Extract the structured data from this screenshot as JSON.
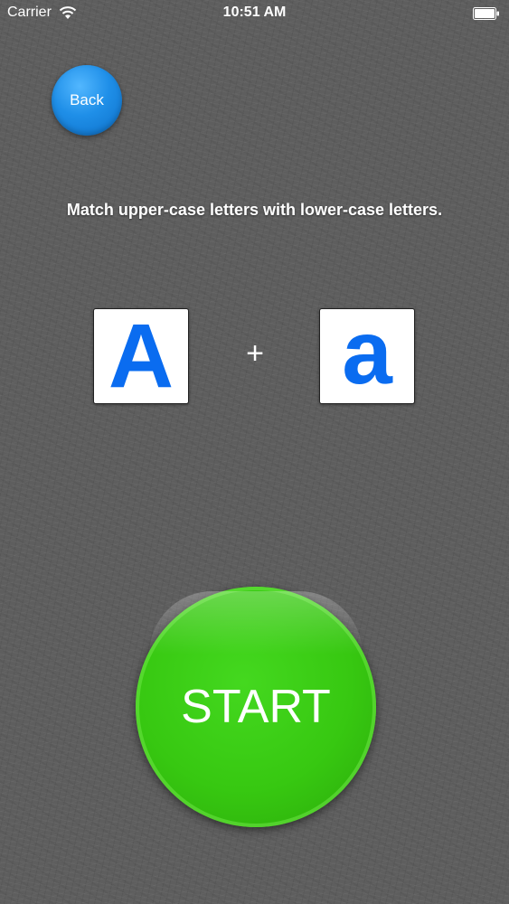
{
  "status_bar": {
    "carrier": "Carrier",
    "time": "10:51 AM",
    "icons": [
      "wifi-icon",
      "battery-icon"
    ]
  },
  "back_button": {
    "label": "Back",
    "color": "#1f8fe8"
  },
  "instructions": "Match upper-case letters with lower-case letters.",
  "example": {
    "upper": "A",
    "plus": "+",
    "lower": "a",
    "letter_color": "#0a6cf0"
  },
  "start_button": {
    "label": "START",
    "color": "#37c811"
  }
}
